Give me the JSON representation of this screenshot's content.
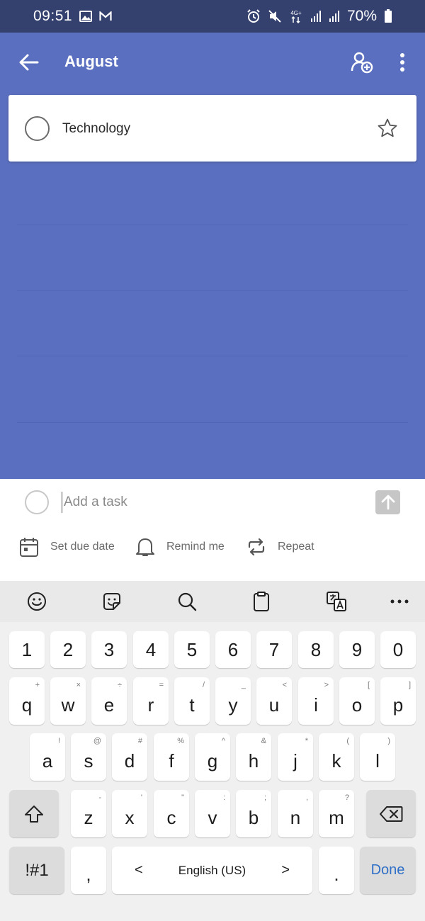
{
  "status_bar": {
    "time": "09:51",
    "battery": "70%",
    "network": "4G+",
    "left_icons": [
      "gallery-icon",
      "gmail-icon"
    ],
    "right_icons": [
      "alarm-icon",
      "mute-icon",
      "data-icon",
      "signal-icon",
      "signal-icon",
      "battery-icon"
    ]
  },
  "app_bar": {
    "title": "August",
    "back_icon": "arrow-left-icon",
    "share_icon": "add-person-icon",
    "more_icon": "more-vert-icon"
  },
  "tasks": [
    {
      "title": "Technology",
      "completed": false,
      "starred": false
    }
  ],
  "add_task": {
    "placeholder": "Add a task",
    "value": "",
    "options": [
      {
        "label": "Set due date",
        "icon": "calendar-icon"
      },
      {
        "label": "Remind me",
        "icon": "bell-icon"
      },
      {
        "label": "Repeat",
        "icon": "repeat-icon"
      }
    ]
  },
  "keyboard": {
    "toolbar": [
      "emoji-icon",
      "sticker-icon",
      "search-icon",
      "clipboard-icon",
      "translate-icon",
      "more-horiz-icon"
    ],
    "row_numbers": [
      "1",
      "2",
      "3",
      "4",
      "5",
      "6",
      "7",
      "8",
      "9",
      "0"
    ],
    "row_q": [
      {
        "key": "q",
        "hint": "+"
      },
      {
        "key": "w",
        "hint": "×"
      },
      {
        "key": "e",
        "hint": "÷"
      },
      {
        "key": "r",
        "hint": "="
      },
      {
        "key": "t",
        "hint": "/"
      },
      {
        "key": "y",
        "hint": "_"
      },
      {
        "key": "u",
        "hint": "<"
      },
      {
        "key": "i",
        "hint": ">"
      },
      {
        "key": "o",
        "hint": "["
      },
      {
        "key": "p",
        "hint": "]"
      }
    ],
    "row_a": [
      {
        "key": "a",
        "hint": "!"
      },
      {
        "key": "s",
        "hint": "@"
      },
      {
        "key": "d",
        "hint": "#"
      },
      {
        "key": "f",
        "hint": "%"
      },
      {
        "key": "g",
        "hint": "^"
      },
      {
        "key": "h",
        "hint": "&"
      },
      {
        "key": "j",
        "hint": "*"
      },
      {
        "key": "k",
        "hint": "("
      },
      {
        "key": "l",
        "hint": ")"
      }
    ],
    "row_z": [
      {
        "key": "z",
        "hint": "-"
      },
      {
        "key": "x",
        "hint": "'"
      },
      {
        "key": "c",
        "hint": "\""
      },
      {
        "key": "v",
        "hint": ":"
      },
      {
        "key": "b",
        "hint": ";"
      },
      {
        "key": "n",
        "hint": ","
      },
      {
        "key": "m",
        "hint": "?"
      }
    ],
    "symbols_key": "!#1",
    "comma_key": ",",
    "space_label": "English (US)",
    "space_prev": "<",
    "space_next": ">",
    "period_key": ".",
    "done_key": "Done"
  },
  "colors": {
    "status_bar": "#34416f",
    "list_background": "#5b6fc0",
    "accent": "#2f6fc7"
  }
}
